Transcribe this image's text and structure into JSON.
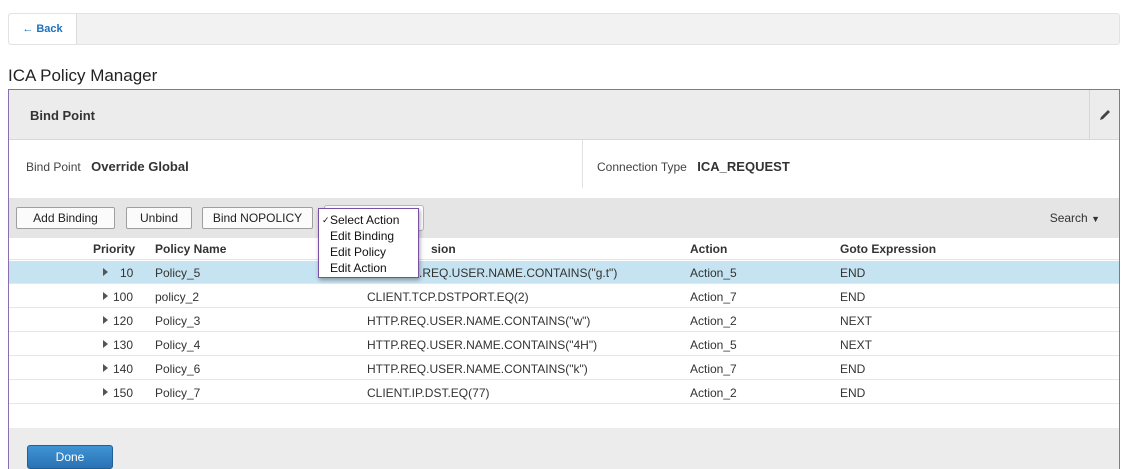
{
  "topbar": {
    "back_label": "Back"
  },
  "page": {
    "title": "ICA Policy Manager"
  },
  "bind_point": {
    "header": "Bind Point",
    "bind_point_label": "Bind Point",
    "bind_point_value": "Override Global",
    "connection_type_label": "Connection Type",
    "connection_type_value": "ICA_REQUEST"
  },
  "toolbar": {
    "add_binding": "Add Binding",
    "unbind": "Unbind",
    "bind_nopolicy": "Bind NOPOLICY",
    "search": "Search"
  },
  "action_menu": {
    "items": [
      "Select Action",
      "Edit Binding",
      "Edit Policy",
      "Edit Action"
    ],
    "selected": "Select Action"
  },
  "table": {
    "columns": [
      "Priority",
      "Policy Name",
      "Expression",
      "Action",
      "Goto Expression"
    ],
    "visible_header_fragment": "sion",
    "rows": [
      {
        "priority": "10",
        "policy_name": "Policy_5",
        "expression": "HTTP.REQ.USER.NAME.CONTAINS(\"g.t\")",
        "expression_visible": ".REQ.USER.NAME.CONTAINS(\"g.t\")",
        "action": "Action_5",
        "goto": "END"
      },
      {
        "priority": "100",
        "policy_name": "policy_2",
        "expression": "CLIENT.TCP.DSTPORT.EQ(2)",
        "action": "Action_7",
        "goto": "END"
      },
      {
        "priority": "120",
        "policy_name": "Policy_3",
        "expression": "HTTP.REQ.USER.NAME.CONTAINS(\"w\")",
        "action": "Action_2",
        "goto": "NEXT"
      },
      {
        "priority": "130",
        "policy_name": "Policy_4",
        "expression": "HTTP.REQ.USER.NAME.CONTAINS(\"4H\")",
        "action": "Action_5",
        "goto": "NEXT"
      },
      {
        "priority": "140",
        "policy_name": "Policy_6",
        "expression": "HTTP.REQ.USER.NAME.CONTAINS(\"k\")",
        "action": "Action_7",
        "goto": "END"
      },
      {
        "priority": "150",
        "policy_name": "Policy_7",
        "expression": "CLIENT.IP.DST.EQ(77)",
        "action": "Action_2",
        "goto": "END"
      }
    ]
  },
  "footer": {
    "done_label": "Done"
  },
  "colors": {
    "selected_row": "#c6e3f1",
    "done_button": "#2f7ec1",
    "panel_border": "#8a6fb0",
    "link": "#1a73c4"
  },
  "icons": [
    "back-arrow-icon",
    "pencil-icon",
    "caret-down-icon",
    "expand-caret-icon",
    "checkmark-icon"
  ]
}
